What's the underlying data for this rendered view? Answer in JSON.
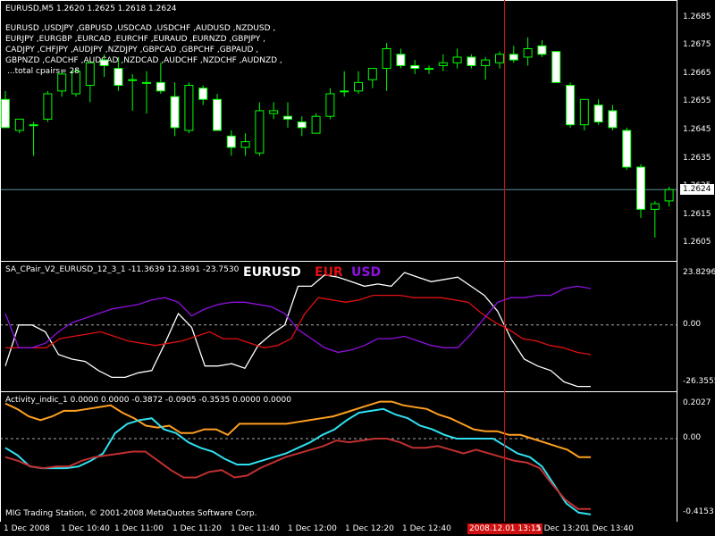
{
  "main": {
    "header": "EURUSD,M5  1.2620 1.2625 1.2618 1.2624",
    "pairs_lines": [
      "EURUSD ,USDJPY ,GBPUSD ,USDCAD ,USDCHF ,AUDUSD ,NZDUSD ,",
      "EURJPY ,EURGBP ,EURCAD ,EURCHF ,EURAUD ,EURNZD ,GBPJPY ,",
      "CADJPY ,CHFJPY ,AUDJPY ,NZDJPY ,GBPCAD ,GBPCHF ,GBPAUD ,",
      "GBPNZD ,CADCHF ,AUDCAD ,NZDCAD ,AUDCHF ,NZDCHF ,AUDNZD ,"
    ],
    "total_pairs": "...total cpairs= 28",
    "price_ticks": [
      "1.2685",
      "1.2675",
      "1.2665",
      "1.2655",
      "1.2645",
      "1.2635",
      "1.2625",
      "1.2615",
      "1.2605"
    ],
    "current_price": "1.2624",
    "ylim": [
      1.26,
      1.269
    ],
    "candles": [
      {
        "o": 1.2656,
        "h": 1.2659,
        "l": 1.2647,
        "c": 1.2646
      },
      {
        "o": 1.2645,
        "h": 1.2649,
        "l": 1.2644,
        "c": 1.2649
      },
      {
        "o": 1.2647,
        "h": 1.2648,
        "l": 1.2636,
        "c": 1.2647
      },
      {
        "o": 1.2649,
        "h": 1.2659,
        "l": 1.2648,
        "c": 1.2658
      },
      {
        "o": 1.2659,
        "h": 1.2666,
        "l": 1.2657,
        "c": 1.2665
      },
      {
        "o": 1.2658,
        "h": 1.2667,
        "l": 1.2657,
        "c": 1.2666
      },
      {
        "o": 1.2661,
        "h": 1.267,
        "l": 1.2655,
        "c": 1.2669
      },
      {
        "o": 1.267,
        "h": 1.2672,
        "l": 1.2664,
        "c": 1.2668
      },
      {
        "o": 1.2667,
        "h": 1.2671,
        "l": 1.2659,
        "c": 1.2661
      },
      {
        "o": 1.2663,
        "h": 1.2665,
        "l": 1.2652,
        "c": 1.2663
      },
      {
        "o": 1.2662,
        "h": 1.2666,
        "l": 1.2651,
        "c": 1.2662
      },
      {
        "o": 1.2662,
        "h": 1.2669,
        "l": 1.2658,
        "c": 1.2659
      },
      {
        "o": 1.2657,
        "h": 1.2662,
        "l": 1.2643,
        "c": 1.2646
      },
      {
        "o": 1.2645,
        "h": 1.2662,
        "l": 1.2644,
        "c": 1.2661
      },
      {
        "o": 1.266,
        "h": 1.2661,
        "l": 1.2654,
        "c": 1.2656
      },
      {
        "o": 1.2656,
        "h": 1.2658,
        "l": 1.2645,
        "c": 1.2645
      },
      {
        "o": 1.2643,
        "h": 1.2645,
        "l": 1.2636,
        "c": 1.2639
      },
      {
        "o": 1.2639,
        "h": 1.2644,
        "l": 1.2636,
        "c": 1.2641
      },
      {
        "o": 1.2637,
        "h": 1.2655,
        "l": 1.2636,
        "c": 1.2652
      },
      {
        "o": 1.2651,
        "h": 1.2655,
        "l": 1.2649,
        "c": 1.2652
      },
      {
        "o": 1.265,
        "h": 1.2655,
        "l": 1.2646,
        "c": 1.2649
      },
      {
        "o": 1.2648,
        "h": 1.265,
        "l": 1.2643,
        "c": 1.2646
      },
      {
        "o": 1.2644,
        "h": 1.2651,
        "l": 1.2644,
        "c": 1.265
      },
      {
        "o": 1.265,
        "h": 1.266,
        "l": 1.2649,
        "c": 1.2658
      },
      {
        "o": 1.2659,
        "h": 1.2666,
        "l": 1.2657,
        "c": 1.2659
      },
      {
        "o": 1.2659,
        "h": 1.2666,
        "l": 1.2658,
        "c": 1.2662
      },
      {
        "o": 1.2663,
        "h": 1.2667,
        "l": 1.266,
        "c": 1.2667
      },
      {
        "o": 1.2667,
        "h": 1.2676,
        "l": 1.2659,
        "c": 1.2674
      },
      {
        "o": 1.2672,
        "h": 1.2674,
        "l": 1.2667,
        "c": 1.2668
      },
      {
        "o": 1.2668,
        "h": 1.267,
        "l": 1.2665,
        "c": 1.2667
      },
      {
        "o": 1.2667,
        "h": 1.2668,
        "l": 1.2665,
        "c": 1.2667
      },
      {
        "o": 1.2668,
        "h": 1.2672,
        "l": 1.2666,
        "c": 1.2669
      },
      {
        "o": 1.2669,
        "h": 1.2674,
        "l": 1.2667,
        "c": 1.2671
      },
      {
        "o": 1.2671,
        "h": 1.2672,
        "l": 1.2667,
        "c": 1.2668
      },
      {
        "o": 1.2668,
        "h": 1.2671,
        "l": 1.2663,
        "c": 1.267
      },
      {
        "o": 1.2669,
        "h": 1.2673,
        "l": 1.2667,
        "c": 1.2672
      },
      {
        "o": 1.2672,
        "h": 1.2675,
        "l": 1.2669,
        "c": 1.267
      },
      {
        "o": 1.2671,
        "h": 1.2678,
        "l": 1.2668,
        "c": 1.2674
      },
      {
        "o": 1.2675,
        "h": 1.2677,
        "l": 1.2671,
        "c": 1.2672
      },
      {
        "o": 1.2673,
        "h": 1.2673,
        "l": 1.2662,
        "c": 1.2662
      },
      {
        "o": 1.2661,
        "h": 1.2662,
        "l": 1.2646,
        "c": 1.2647
      },
      {
        "o": 1.2647,
        "h": 1.2656,
        "l": 1.2645,
        "c": 1.2656
      },
      {
        "o": 1.2654,
        "h": 1.2656,
        "l": 1.2647,
        "c": 1.2648
      },
      {
        "o": 1.2652,
        "h": 1.2654,
        "l": 1.2645,
        "c": 1.2646
      },
      {
        "o": 1.2645,
        "h": 1.2646,
        "l": 1.2631,
        "c": 1.2632
      },
      {
        "o": 1.2632,
        "h": 1.2633,
        "l": 1.2614,
        "c": 1.2617
      },
      {
        "o": 1.2617,
        "h": 1.262,
        "l": 1.2607,
        "c": 1.2619
      },
      {
        "o": 1.262,
        "h": 1.2625,
        "l": 1.2618,
        "c": 1.2624
      }
    ],
    "colors": {
      "bull": "#000000",
      "bear": "#ffffff",
      "bull_border": "#00ff00",
      "wick": "#00ff00",
      "price_line": "#5f8fa0"
    }
  },
  "cpair": {
    "header": "SA_CPair_V2_EURUSD_12_3_1 -11.3639 12.3891 -23.7530",
    "label_pair": "EURUSD",
    "label_base": "EUR",
    "label_quote": "USD",
    "ticks": [
      "23.8296",
      "0.00",
      "-26.3555"
    ],
    "ylim": [
      -26.3555,
      23.8296
    ],
    "series": [
      {
        "color": "#ffffff",
        "values": [
          -18,
          0,
          0,
          -3,
          -13,
          -15,
          -16,
          -20,
          -23,
          -23,
          -21,
          -20,
          -8,
          5,
          -1,
          -18,
          -18,
          -17,
          -19,
          -9,
          -4,
          0,
          17,
          17,
          22,
          21,
          19,
          17,
          18,
          17,
          23,
          21,
          19,
          20,
          21,
          17,
          13,
          6,
          -6,
          -15,
          -18,
          -20,
          -25,
          -27,
          -27
        ]
      },
      {
        "color": "#e01010",
        "values": [
          -10,
          -10,
          -10,
          -10,
          -6,
          -5,
          -4,
          -3,
          -5,
          -7,
          -8,
          -9,
          -8,
          -7,
          -5,
          -3,
          -6,
          -6,
          -8,
          -10,
          -9,
          -6,
          5,
          12,
          11,
          10,
          11,
          13,
          13,
          13,
          12,
          12,
          12,
          11,
          10,
          5,
          1,
          -2,
          -6,
          -7,
          -9,
          -10,
          -12,
          -13
        ]
      },
      {
        "color": "#9010e0",
        "values": [
          5,
          -10,
          -10,
          -8,
          -3,
          1,
          3,
          5,
          7,
          8,
          9,
          11,
          12,
          10,
          4,
          7,
          9,
          10,
          10,
          9,
          8,
          5,
          -2,
          -6,
          -10,
          -12,
          -11,
          -9,
          -6,
          -6,
          -5,
          -7,
          -9,
          -10,
          -10,
          -4,
          3,
          10,
          12,
          12,
          13,
          13,
          16,
          17,
          16
        ]
      }
    ],
    "colors": {
      "eurusd": "#ffffff",
      "eur": "#e01010",
      "usd": "#9010e0"
    }
  },
  "activity": {
    "header": "Activity_indic_1 0.0000 0.0000 -0.3872 -0.0905 -0.3535 0.0000 0.0000",
    "ticks": [
      "0.2027",
      "0.00",
      "-0.4153"
    ],
    "ylim": [
      -0.4153,
      0.2027
    ],
    "series": [
      {
        "color": "#ffa020",
        "values": [
          0.19,
          0.16,
          0.12,
          0.1,
          0.12,
          0.15,
          0.15,
          0.16,
          0.17,
          0.18,
          0.14,
          0.11,
          0.07,
          0.06,
          0.07,
          0.03,
          0.03,
          0.05,
          0.05,
          0.02,
          0.08,
          0.08,
          0.08,
          0.08,
          0.08,
          0.09,
          0.1,
          0.11,
          0.12,
          0.14,
          0.16,
          0.18,
          0.2,
          0.2,
          0.18,
          0.17,
          0.16,
          0.13,
          0.11,
          0.08,
          0.05,
          0.04,
          0.04,
          0.02,
          0.02,
          0.0,
          -0.02,
          -0.04,
          -0.06,
          -0.1,
          -0.1
        ]
      },
      {
        "color": "#30e0f0",
        "values": [
          -0.05,
          -0.09,
          -0.15,
          -0.16,
          -0.16,
          -0.16,
          -0.15,
          -0.12,
          -0.08,
          0.03,
          0.08,
          0.1,
          0.11,
          0.05,
          0.03,
          -0.02,
          -0.05,
          -0.07,
          -0.11,
          -0.14,
          -0.14,
          -0.12,
          -0.1,
          -0.08,
          -0.05,
          -0.02,
          0.02,
          0.05,
          0.1,
          0.14,
          0.15,
          0.16,
          0.13,
          0.11,
          0.07,
          0.05,
          0.02,
          0.0,
          0.0,
          0.0,
          0.0,
          -0.04,
          -0.08,
          -0.1,
          -0.15,
          -0.25,
          -0.35,
          -0.4,
          -0.41
        ]
      },
      {
        "color": "#c03030",
        "values": [
          -0.1,
          -0.12,
          -0.15,
          -0.16,
          -0.15,
          -0.15,
          -0.12,
          -0.1,
          -0.09,
          -0.08,
          -0.07,
          -0.07,
          -0.12,
          -0.17,
          -0.21,
          -0.21,
          -0.18,
          -0.17,
          -0.21,
          -0.2,
          -0.16,
          -0.13,
          -0.1,
          -0.08,
          -0.06,
          -0.04,
          -0.01,
          -0.02,
          -0.01,
          0.0,
          0.0,
          -0.02,
          -0.05,
          -0.05,
          -0.04,
          -0.06,
          -0.08,
          -0.06,
          -0.08,
          -0.1,
          -0.12,
          -0.13,
          -0.16,
          -0.25,
          -0.33,
          -0.38,
          -0.38
        ]
      }
    ]
  },
  "footer": {
    "copyright": "MIG Trading Station, © 2001-2008 MetaQuotes Software Corp."
  },
  "time_axis": {
    "labels": [
      "1 Dec 2008",
      "1 Dec 10:40",
      "1 Dec 11:00",
      "1 Dec 11:20",
      "1 Dec 11:40",
      "1 Dec 12:00",
      "1 Dec 12:20",
      "1 Dec 12:40",
      "2008.12.01 13:15",
      "1 Dec 13:20",
      "1 Dec 13:40"
    ],
    "highlight_label": "2008.12.01 13:15",
    "highlight_color": "#d01010"
  },
  "crosshair_color": "#d01010"
}
